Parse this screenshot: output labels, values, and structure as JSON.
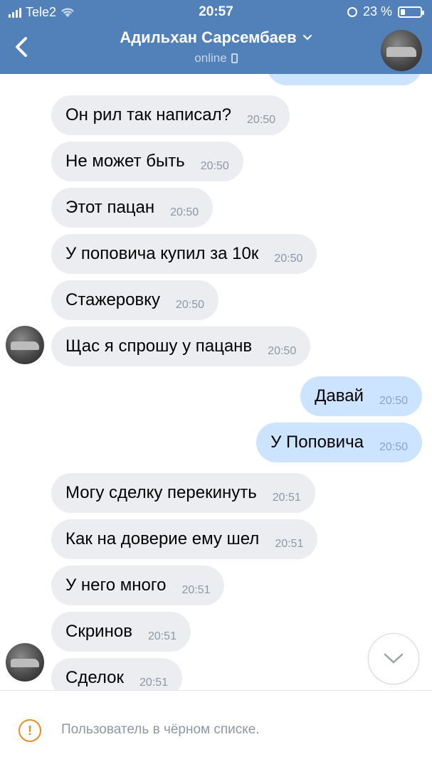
{
  "status_bar": {
    "carrier": "Tele2",
    "time": "20:57",
    "battery": "23 %",
    "battery_level": 0.23
  },
  "header": {
    "title": "Адильхан Сарсембаев",
    "subtitle": "online"
  },
  "messages": [
    {
      "text": "Он рил так написал?",
      "time": "20:50",
      "dir": "in"
    },
    {
      "text": "Не может быть",
      "time": "20:50",
      "dir": "in"
    },
    {
      "text": "Этот пацан",
      "time": "20:50",
      "dir": "in"
    },
    {
      "text": "У поповича купил за 10к",
      "time": "20:50",
      "dir": "in"
    },
    {
      "text": "Стажеровку",
      "time": "20:50",
      "dir": "in"
    },
    {
      "text": "Щас я спрошу у пацанв",
      "time": "20:50",
      "dir": "in"
    },
    {
      "text": "Давай",
      "time": "20:50",
      "dir": "out"
    },
    {
      "text": "У Поповича",
      "time": "20:50",
      "dir": "out"
    },
    {
      "text": "Могу сделку перекинуть",
      "time": "20:51",
      "dir": "in"
    },
    {
      "text": "Как на доверие ему шел",
      "time": "20:51",
      "dir": "in"
    },
    {
      "text": "У него много",
      "time": "20:51",
      "dir": "in"
    },
    {
      "text": "Скринов",
      "time": "20:51",
      "dir": "in"
    },
    {
      "text": "Сделок",
      "time": "20:51",
      "dir": "in"
    }
  ],
  "footer": {
    "notice": "Пользователь в чёрном списке."
  },
  "colors": {
    "header": "#5181b8",
    "incoming": "#ebedf0",
    "outgoing": "#cce4ff",
    "warning": "#e88c24"
  },
  "icons": [
    "signal-icon",
    "wifi-icon",
    "rotation-lock-icon",
    "battery-icon",
    "back-chevron-icon",
    "chevron-down-icon",
    "mobile-phone-icon",
    "scroll-down-icon",
    "warning-icon"
  ]
}
